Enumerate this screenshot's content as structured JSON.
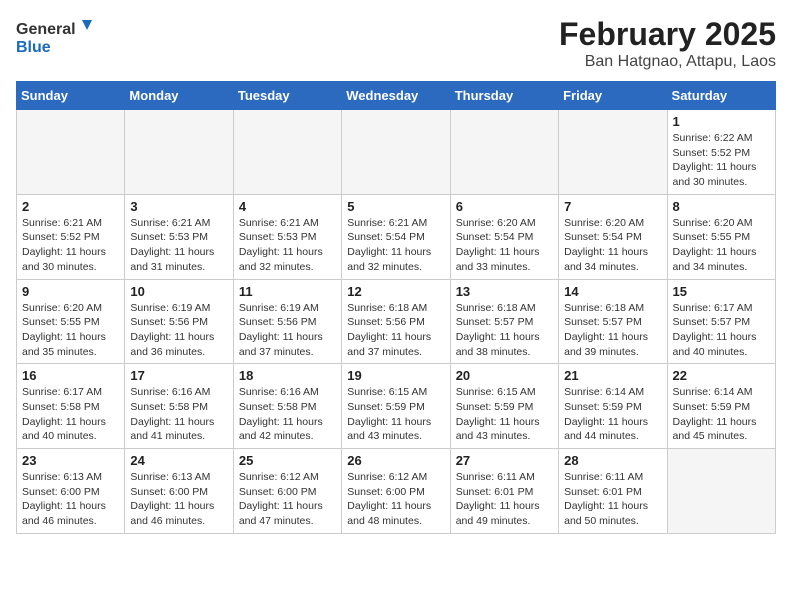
{
  "header": {
    "logo_general": "General",
    "logo_blue": "Blue",
    "main_title": "February 2025",
    "subtitle": "Ban Hatgnao, Attapu, Laos"
  },
  "days_of_week": [
    "Sunday",
    "Monday",
    "Tuesday",
    "Wednesday",
    "Thursday",
    "Friday",
    "Saturday"
  ],
  "weeks": [
    [
      {
        "day": "",
        "info": ""
      },
      {
        "day": "",
        "info": ""
      },
      {
        "day": "",
        "info": ""
      },
      {
        "day": "",
        "info": ""
      },
      {
        "day": "",
        "info": ""
      },
      {
        "day": "",
        "info": ""
      },
      {
        "day": "1",
        "info": "Sunrise: 6:22 AM\nSunset: 5:52 PM\nDaylight: 11 hours and 30 minutes."
      }
    ],
    [
      {
        "day": "2",
        "info": "Sunrise: 6:21 AM\nSunset: 5:52 PM\nDaylight: 11 hours and 30 minutes."
      },
      {
        "day": "3",
        "info": "Sunrise: 6:21 AM\nSunset: 5:53 PM\nDaylight: 11 hours and 31 minutes."
      },
      {
        "day": "4",
        "info": "Sunrise: 6:21 AM\nSunset: 5:53 PM\nDaylight: 11 hours and 32 minutes."
      },
      {
        "day": "5",
        "info": "Sunrise: 6:21 AM\nSunset: 5:54 PM\nDaylight: 11 hours and 32 minutes."
      },
      {
        "day": "6",
        "info": "Sunrise: 6:20 AM\nSunset: 5:54 PM\nDaylight: 11 hours and 33 minutes."
      },
      {
        "day": "7",
        "info": "Sunrise: 6:20 AM\nSunset: 5:54 PM\nDaylight: 11 hours and 34 minutes."
      },
      {
        "day": "8",
        "info": "Sunrise: 6:20 AM\nSunset: 5:55 PM\nDaylight: 11 hours and 34 minutes."
      }
    ],
    [
      {
        "day": "9",
        "info": "Sunrise: 6:20 AM\nSunset: 5:55 PM\nDaylight: 11 hours and 35 minutes."
      },
      {
        "day": "10",
        "info": "Sunrise: 6:19 AM\nSunset: 5:56 PM\nDaylight: 11 hours and 36 minutes."
      },
      {
        "day": "11",
        "info": "Sunrise: 6:19 AM\nSunset: 5:56 PM\nDaylight: 11 hours and 37 minutes."
      },
      {
        "day": "12",
        "info": "Sunrise: 6:18 AM\nSunset: 5:56 PM\nDaylight: 11 hours and 37 minutes."
      },
      {
        "day": "13",
        "info": "Sunrise: 6:18 AM\nSunset: 5:57 PM\nDaylight: 11 hours and 38 minutes."
      },
      {
        "day": "14",
        "info": "Sunrise: 6:18 AM\nSunset: 5:57 PM\nDaylight: 11 hours and 39 minutes."
      },
      {
        "day": "15",
        "info": "Sunrise: 6:17 AM\nSunset: 5:57 PM\nDaylight: 11 hours and 40 minutes."
      }
    ],
    [
      {
        "day": "16",
        "info": "Sunrise: 6:17 AM\nSunset: 5:58 PM\nDaylight: 11 hours and 40 minutes."
      },
      {
        "day": "17",
        "info": "Sunrise: 6:16 AM\nSunset: 5:58 PM\nDaylight: 11 hours and 41 minutes."
      },
      {
        "day": "18",
        "info": "Sunrise: 6:16 AM\nSunset: 5:58 PM\nDaylight: 11 hours and 42 minutes."
      },
      {
        "day": "19",
        "info": "Sunrise: 6:15 AM\nSunset: 5:59 PM\nDaylight: 11 hours and 43 minutes."
      },
      {
        "day": "20",
        "info": "Sunrise: 6:15 AM\nSunset: 5:59 PM\nDaylight: 11 hours and 43 minutes."
      },
      {
        "day": "21",
        "info": "Sunrise: 6:14 AM\nSunset: 5:59 PM\nDaylight: 11 hours and 44 minutes."
      },
      {
        "day": "22",
        "info": "Sunrise: 6:14 AM\nSunset: 5:59 PM\nDaylight: 11 hours and 45 minutes."
      }
    ],
    [
      {
        "day": "23",
        "info": "Sunrise: 6:13 AM\nSunset: 6:00 PM\nDaylight: 11 hours and 46 minutes."
      },
      {
        "day": "24",
        "info": "Sunrise: 6:13 AM\nSunset: 6:00 PM\nDaylight: 11 hours and 46 minutes."
      },
      {
        "day": "25",
        "info": "Sunrise: 6:12 AM\nSunset: 6:00 PM\nDaylight: 11 hours and 47 minutes."
      },
      {
        "day": "26",
        "info": "Sunrise: 6:12 AM\nSunset: 6:00 PM\nDaylight: 11 hours and 48 minutes."
      },
      {
        "day": "27",
        "info": "Sunrise: 6:11 AM\nSunset: 6:01 PM\nDaylight: 11 hours and 49 minutes."
      },
      {
        "day": "28",
        "info": "Sunrise: 6:11 AM\nSunset: 6:01 PM\nDaylight: 11 hours and 50 minutes."
      },
      {
        "day": "",
        "info": ""
      }
    ]
  ]
}
